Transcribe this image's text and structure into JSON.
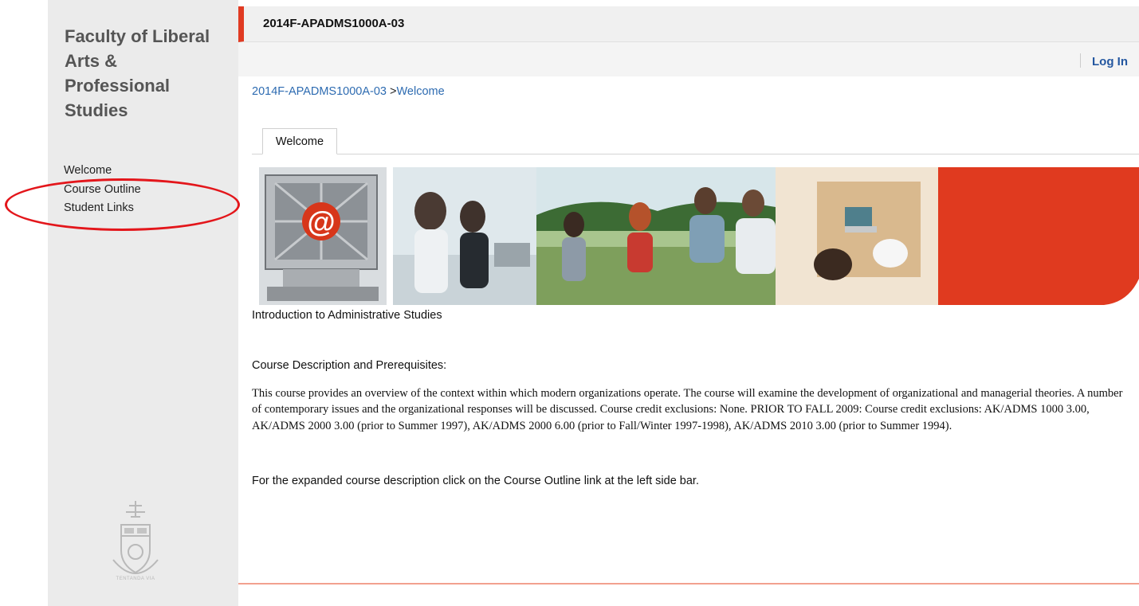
{
  "sidebar": {
    "faculty_title": "Faculty of Liberal Arts & Professional Studies",
    "nav": [
      {
        "label": "Welcome"
      },
      {
        "label": "Course Outline"
      },
      {
        "label": "Student Links"
      }
    ],
    "crest_motto": "TENTANDA VIA"
  },
  "header": {
    "course_code": "2014F-APADMS1000A-03",
    "login_label": "Log In"
  },
  "breadcrumb": {
    "course": "2014F-APADMS1000A-03",
    "separator": ">",
    "current": "Welcome"
  },
  "tabs": [
    {
      "label": "Welcome",
      "active": true
    }
  ],
  "content": {
    "course_name": "Introduction to Administrative Studies",
    "section_heading": "Course Description and Prerequisites:",
    "description": "This course provides an overview of the context within which modern organizations operate. The course will examine the development of organizational and managerial theories. A number of contemporary issues and the organizational responses will be discussed. Course credit exclusions: None. PRIOR TO FALL 2009: Course credit exclusions: AK/ADMS 1000 3.00, AK/ADMS 2000 3.00 (prior to Summer 1997), AK/ADMS 2000 6.00 (prior to Fall/Winter 1997-1998), AK/ADMS 2010 3.00 (prior to Summer 1994).",
    "note": "For the expanded course description click on the Course Outline link at the left side bar."
  },
  "colors": {
    "accent_red": "#e03a22",
    "link_blue": "#2d6bb1",
    "annotation_red": "#e3161b",
    "sidebar_bg": "#ebebeb"
  },
  "icons": [
    "at-sign-monitor-icon",
    "university-crest-icon"
  ]
}
